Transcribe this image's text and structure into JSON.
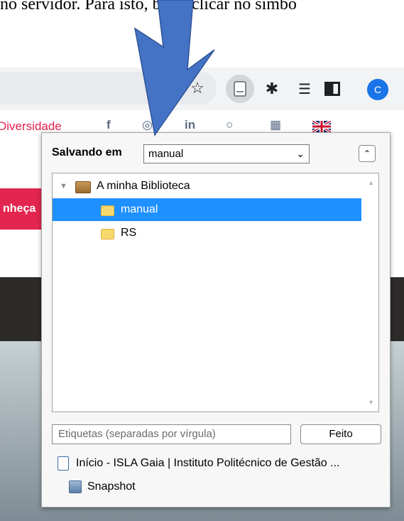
{
  "document": {
    "caption_fragment": "no servidor. Para isto, basta clicar no símbo"
  },
  "browser_toolbar": {
    "avatar_letter": "C",
    "icons": [
      "star-icon",
      "zotero-document-icon",
      "puzzle-extension-icon",
      "reading-list-icon",
      "side-panel-icon",
      "profile-avatar-icon"
    ]
  },
  "bookmarks_bar": {
    "items": [
      "Diversidade",
      "f",
      "◎",
      "in",
      "○",
      "▦"
    ],
    "flag": "uk-flag-icon"
  },
  "page": {
    "pink_text": "nheça"
  },
  "popup": {
    "saving_label": "Salvando em",
    "selected_collection": "manual",
    "tree": [
      {
        "label": "A minha Biblioteca",
        "level": 0,
        "expanded": true,
        "selected": false,
        "icon": "library-icon"
      },
      {
        "label": "manual",
        "level": 1,
        "selected": true,
        "icon": "folder-icon"
      },
      {
        "label": "RS",
        "level": 1,
        "selected": false,
        "icon": "folder-icon"
      }
    ],
    "tags_placeholder": "Etiquetas (separadas por vírgula)",
    "done_label": "Feito",
    "item_title": "Início - ISLA Gaia | Instituto Politécnico de Gestão ...",
    "attachment_label": "Snapshot"
  },
  "colors": {
    "selection": "#1e90ff",
    "arrow": "#4472c4",
    "brand_pink": "#e3264f"
  }
}
